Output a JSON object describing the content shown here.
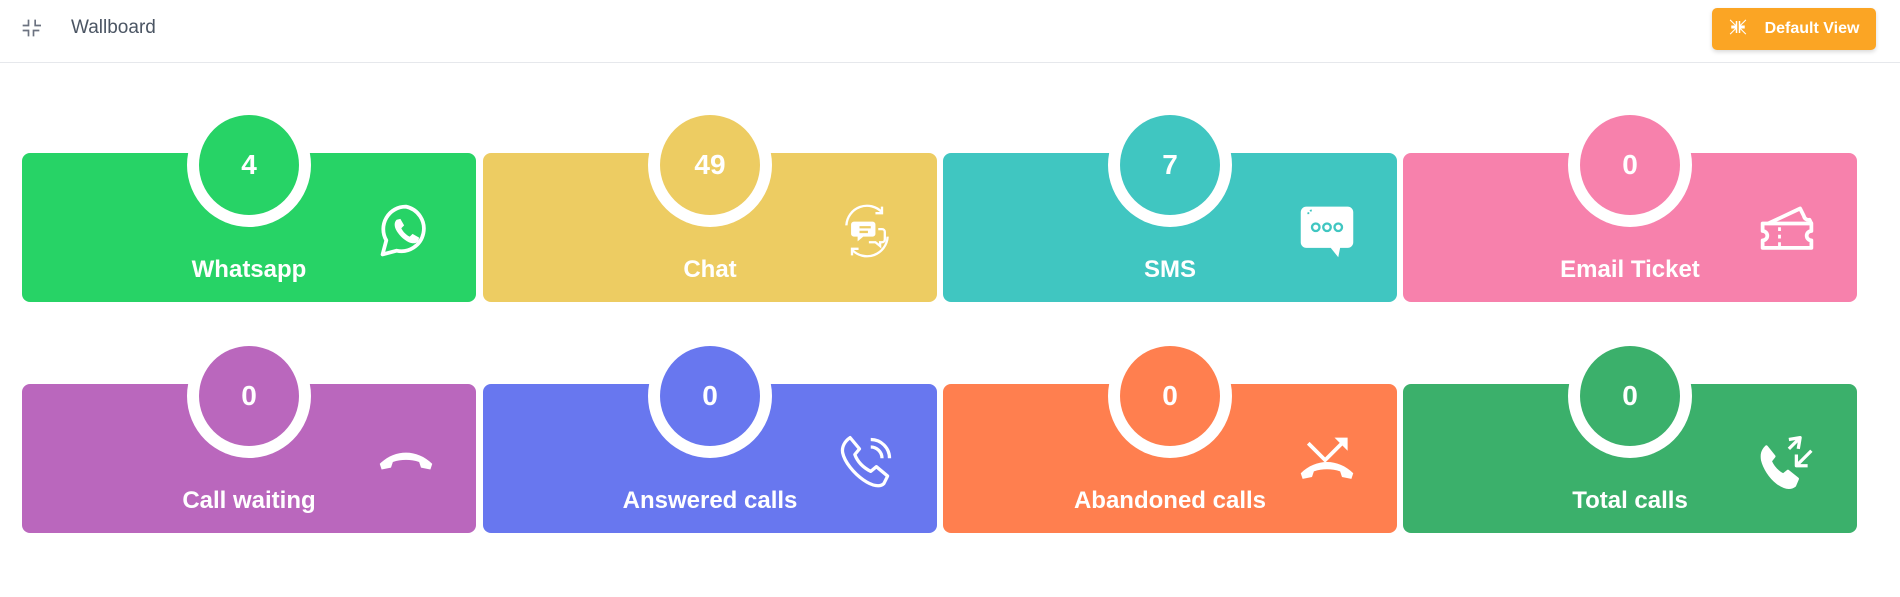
{
  "header": {
    "title": "Wallboard",
    "default_view_label": "Default View",
    "collapse_icon": "collapse-icon",
    "button_icon": "collapse-arrows-icon",
    "accent": "#fba524"
  },
  "tiles": [
    {
      "label": "Whatsapp",
      "count": "4",
      "color": "#27d366",
      "icon": "whatsapp-icon"
    },
    {
      "label": "Chat",
      "count": "49",
      "color": "#edcc62",
      "icon": "chat-icon"
    },
    {
      "label": "SMS",
      "count": "7",
      "color": "#40c6c1",
      "icon": "sms-icon"
    },
    {
      "label": "Email Ticket",
      "count": "0",
      "color": "#f781ac",
      "icon": "ticket-icon"
    },
    {
      "label": "Call waiting",
      "count": "0",
      "color": "#ba67bd",
      "icon": "phone-hangup-icon"
    },
    {
      "label": "Answered calls",
      "count": "0",
      "color": "#6877ef",
      "icon": "phone-ringing-icon"
    },
    {
      "label": "Abandoned calls",
      "count": "0",
      "color": "#ff7f4f",
      "icon": "phone-missed-icon"
    },
    {
      "label": "Total calls",
      "count": "0",
      "color": "#3bb06b",
      "icon": "phone-incoming-icon"
    }
  ]
}
